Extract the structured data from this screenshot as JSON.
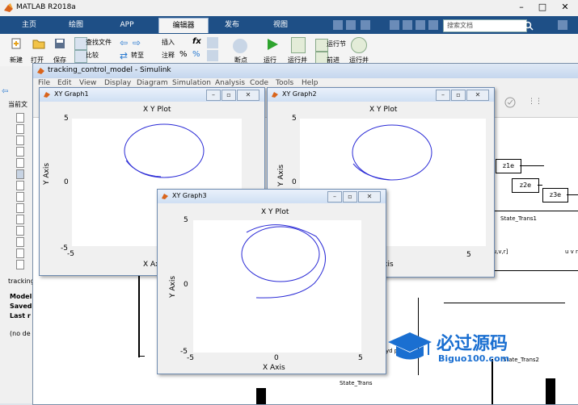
{
  "matlab": {
    "title": "MATLAB R2018a",
    "tabs": [
      "主页",
      "绘图",
      "APP",
      "编辑器",
      "发布",
      "视图"
    ],
    "active_tab": "编辑器",
    "search_placeholder": "搜索文档",
    "ribbon": {
      "new": "新建",
      "open": "打开",
      "save": "保存",
      "find_files": "查找文件",
      "compare": "比较",
      "goto": "转至",
      "insert": "插入",
      "comment": "注释",
      "breakpoint": "断点",
      "run": "运行",
      "run_advance": "运行并",
      "run_section": "运行节",
      "advance": "前进",
      "run_time": "运行并",
      "fx": "fx"
    },
    "left_panel": {
      "current_folder_label": "当前文",
      "detail_title": "tracking",
      "details": [
        "Model",
        "Saved",
        "Last r"
      ],
      "no_details": "(no de"
    }
  },
  "simulink": {
    "title": "tracking_control_model - Simulink",
    "menu": [
      "File",
      "Edit",
      "View",
      "Display",
      "Diagram",
      "Simulation",
      "Analysis",
      "Code",
      "Tools",
      "Help"
    ],
    "blocks": {
      "z1e": "z1e",
      "z2e": "z2e",
      "z3e": "z3e"
    },
    "labels": {
      "state_trans1": "State_Trans1",
      "state_trans2": "State_Trans2",
      "state_trans": "State_Trans",
      "uvr": "[u,v,r]",
      "uvr2": "u v r",
      "yd": "yd p"
    }
  },
  "xy_graphs": [
    {
      "title": "XY Graph1",
      "plot_title": "X Y Plot",
      "xlabel": "X Axis",
      "ylabel": "Y Axis",
      "xticks": [
        "-5"
      ],
      "yticks": [
        "5",
        "0",
        "-5"
      ]
    },
    {
      "title": "XY Graph2",
      "plot_title": "X Y Plot",
      "xlabel": "X Axis",
      "ylabel": "Y Axis",
      "xticks": [
        "5"
      ],
      "yticks": [
        "5",
        "0",
        "-5"
      ]
    },
    {
      "title": "XY Graph3",
      "plot_title": "X Y Plot",
      "xlabel": "X Axis",
      "ylabel": "Y Axis",
      "xticks": [
        "-5",
        "0",
        "5"
      ],
      "yticks": [
        "5",
        "0",
        "-5"
      ]
    }
  ],
  "watermark": {
    "main": "必过源码",
    "sub": "Biguo100.com"
  },
  "colors": {
    "tab_bar": "#1e4f86",
    "plot_line": "#2b2bd6",
    "watermark": "#1a6fd1"
  }
}
